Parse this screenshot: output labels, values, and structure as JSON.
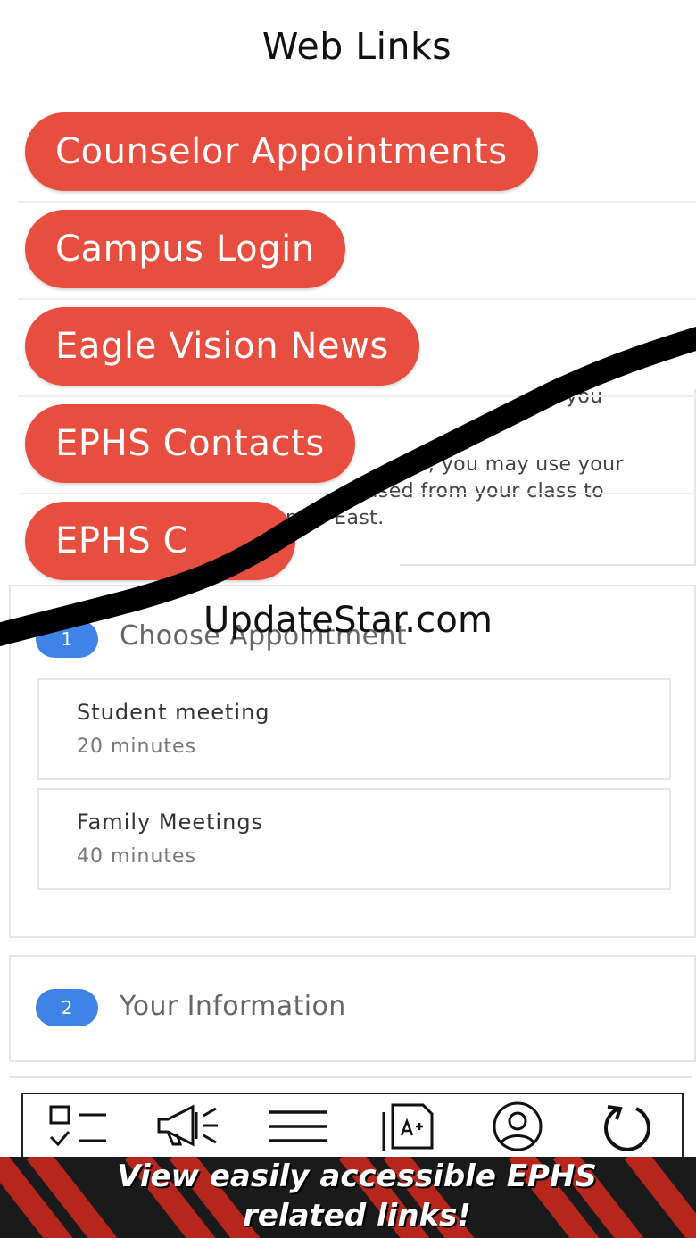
{
  "header": {
    "title": "Web Links"
  },
  "links": [
    {
      "label": "Counselor Appointments"
    },
    {
      "label": "Campus Login"
    },
    {
      "label": "Eagle Vision News"
    },
    {
      "label": "EPHS Contacts"
    },
    {
      "label": "EPHS C"
    }
  ],
  "description": {
    "line1": "you",
    "line2": "e, you may use your",
    "line3": "xcused from your class to",
    "line4": "nter East."
  },
  "appointment": {
    "step1": {
      "number": "1",
      "label": "Choose Appointment"
    },
    "options": [
      {
        "title": "Student meeting",
        "duration": "20 minutes"
      },
      {
        "title": "Family Meetings",
        "duration": "40 minutes"
      }
    ],
    "step2": {
      "number": "2",
      "label": "Your Information"
    }
  },
  "watermark": "UpdateStar.com",
  "bottom_nav": [
    {
      "icon": "checklist-icon"
    },
    {
      "icon": "megaphone-icon"
    },
    {
      "icon": "menu-icon"
    },
    {
      "icon": "grades-icon"
    },
    {
      "icon": "profile-icon"
    },
    {
      "icon": "refresh-icon"
    }
  ],
  "banner": {
    "line1": "View easily accessible EPHS",
    "line2": "related links!"
  },
  "colors": {
    "pill": "#e84e40",
    "step_badge": "#3f83e6",
    "banner_bg": "#1a1a1a",
    "banner_stripe": "#c8281e"
  }
}
